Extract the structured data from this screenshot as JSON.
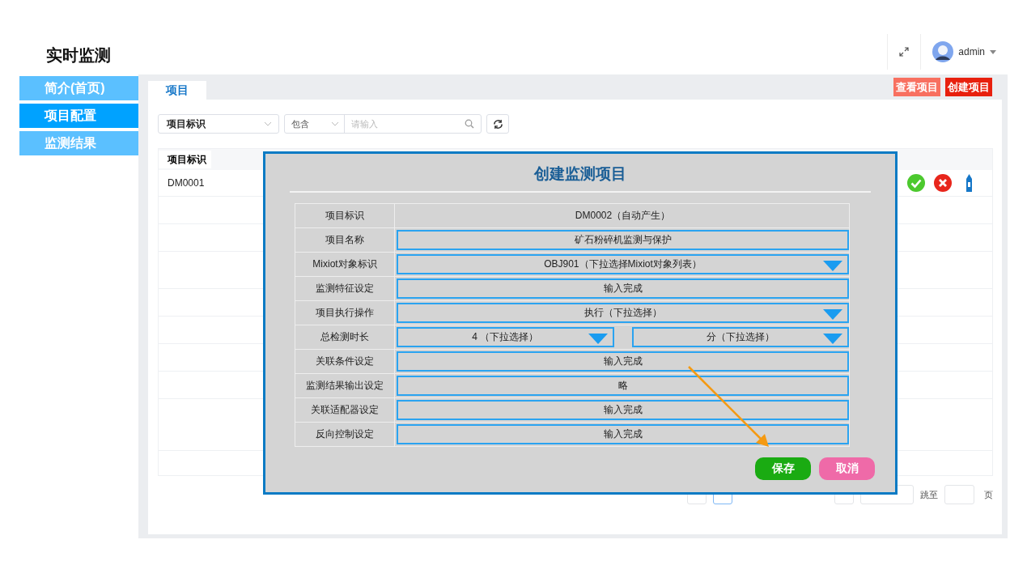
{
  "app_title": "实时监测",
  "header": {
    "user": "admin"
  },
  "sidebar": {
    "items": [
      {
        "label": "简介(首页)",
        "selected": false
      },
      {
        "label": "项目配置",
        "selected": true
      },
      {
        "label": "监测结果",
        "selected": false
      }
    ]
  },
  "tabs": [
    {
      "label": "项目",
      "selected": true
    }
  ],
  "actions": [
    {
      "label": "查看项目",
      "kind": "view"
    },
    {
      "label": "创建项目",
      "kind": "create"
    }
  ],
  "filter": {
    "field": "项目标识",
    "operator": "包含",
    "placeholder": "请输入"
  },
  "table": {
    "columns": [
      "项目标识"
    ],
    "rows": [
      {
        "cells": [
          "DM0001"
        ]
      }
    ]
  },
  "pagination": {
    "jump_label": "跳至",
    "page_suffix": "页"
  },
  "dialog": {
    "title": "创建监测项目",
    "fields": [
      {
        "label": "项目标识",
        "kind": "static",
        "value": "DM0002（自动产生）"
      },
      {
        "label": "项目名称",
        "kind": "input",
        "value": "矿石粉碎机监测与保护"
      },
      {
        "label": "Mixiot对象标识",
        "kind": "select",
        "value": "OBJ901（下拉选择Mixiot对象列表）"
      },
      {
        "label": "监测特征设定",
        "kind": "input",
        "value": "输入完成"
      },
      {
        "label": "项目执行操作",
        "kind": "select",
        "value": "执行（下拉选择）"
      },
      {
        "label": "总检测时长",
        "kind": "select_pair",
        "values": [
          "4 （下拉选择）",
          "分（下拉选择）"
        ]
      },
      {
        "label": "关联条件设定",
        "kind": "input",
        "value": "输入完成"
      },
      {
        "label": "监测结果输出设定",
        "kind": "input",
        "value": "略"
      },
      {
        "label": "关联适配器设定",
        "kind": "input",
        "value": "输入完成"
      },
      {
        "label": "反向控制设定",
        "kind": "input",
        "value": "输入完成"
      }
    ],
    "buttons": [
      {
        "label": "保存",
        "kind": "primary"
      },
      {
        "label": "取消",
        "kind": "cancel"
      }
    ]
  }
}
